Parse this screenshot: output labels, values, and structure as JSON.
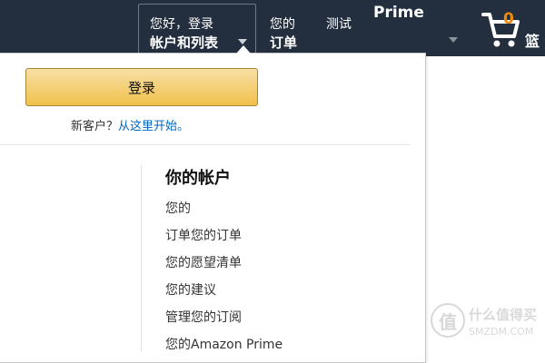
{
  "nav": {
    "account": {
      "greeting": "您好，登录",
      "label": "帐户和列表"
    },
    "orders": {
      "line1": "您的",
      "line2": "订单"
    },
    "test_label": "测试",
    "prime": {
      "label": "Prime"
    },
    "cart": {
      "count": "0",
      "label": "篮"
    }
  },
  "flyout": {
    "signin_button": "登录",
    "new_customer_text": "新客户？",
    "start_here_link": "从这里开始。",
    "your_account": {
      "title": "你的帐户",
      "items": [
        "您的",
        "订单您的订单",
        "您的愿望清单",
        "您的建议",
        "管理您的订阅",
        "您的Amazon Prime"
      ]
    }
  },
  "watermark": {
    "logo_char": "值",
    "line1": "什么值得买",
    "line2": "SMZDM.COM"
  },
  "colors": {
    "nav_background": "#232f3e",
    "cart_count": "#f08804",
    "button_top": "#f7dfa5",
    "button_bottom": "#f0c14b",
    "link": "#0066c0"
  }
}
